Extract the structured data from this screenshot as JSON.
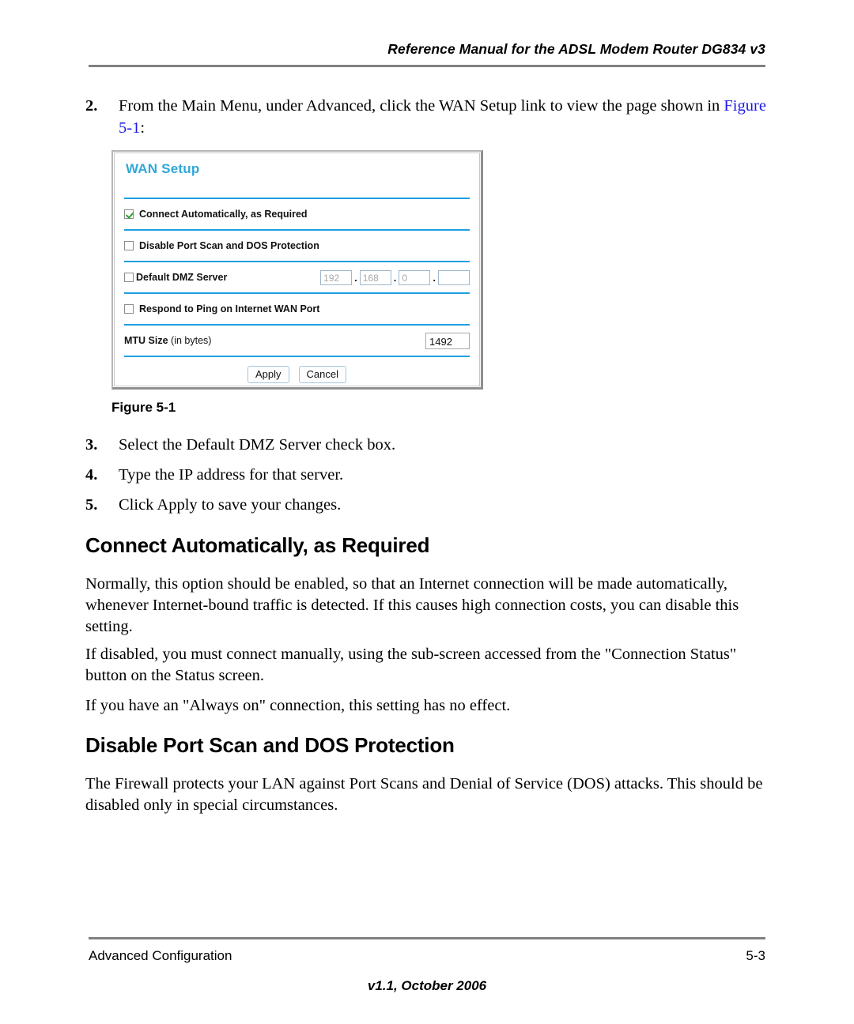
{
  "header": {
    "running_title": "Reference Manual for the ADSL Modem Router DG834 v3"
  },
  "steps": {
    "step2": {
      "number": "2.",
      "text_before": "From the Main Menu, under Advanced, click the WAN Setup link to view the page shown in ",
      "xref": "Figure 5-1",
      "text_after": ":"
    },
    "step3": {
      "number": "3.",
      "text": "Select the Default DMZ Server check box."
    },
    "step4": {
      "number": "4.",
      "text": "Type the IP address for that server."
    },
    "step5": {
      "number": "5.",
      "text": "Click Apply to save your changes."
    }
  },
  "figure": {
    "caption": "Figure 5-1",
    "panel": {
      "title": "WAN Setup",
      "rows": {
        "connect_auto": {
          "label": "Connect Automatically, as Required",
          "checked": true
        },
        "disable_portscan": {
          "label": "Disable Port Scan and DOS Protection",
          "checked": false
        },
        "default_dmz": {
          "label": "Default DMZ Server",
          "checked": false,
          "ip": {
            "octet1": "192",
            "octet2": "168",
            "octet3": "0",
            "octet4": "",
            "separator": "."
          }
        },
        "respond_ping": {
          "label": "Respond to Ping on Internet WAN Port",
          "checked": false
        },
        "mtu": {
          "label": "MTU Size",
          "label_sub": "(in bytes)",
          "value": "1492"
        }
      },
      "buttons": {
        "apply": "Apply",
        "cancel": "Cancel"
      }
    }
  },
  "sections": [
    {
      "heading": "Connect Automatically, as Required",
      "paragraphs": [
        "Normally, this option should be enabled, so that an Internet connection will be made automatically, whenever Internet-bound traffic is detected. If this causes high connection costs, you can disable this setting.",
        "If disabled, you must connect manually, using the sub-screen accessed from the \"Connection Status\" button on the Status screen.",
        "If you have an \"Always on\" connection, this setting has no effect."
      ]
    },
    {
      "heading": "Disable Port Scan and DOS Protection",
      "paragraphs": [
        "The Firewall protects your LAN against Port Scans and Denial of Service (DOS) attacks. This should be disabled only in special circumstances."
      ]
    }
  ],
  "footer": {
    "left": "Advanced Configuration",
    "right": "5-3",
    "version": "v1.1, October 2006"
  },
  "colors": {
    "xref_blue": "#1a1ae6",
    "panel_title_blue": "#2fa8d8",
    "separator_blue": "#1f9fe0",
    "check_green": "#29a329",
    "rule_grey": "#808080"
  }
}
